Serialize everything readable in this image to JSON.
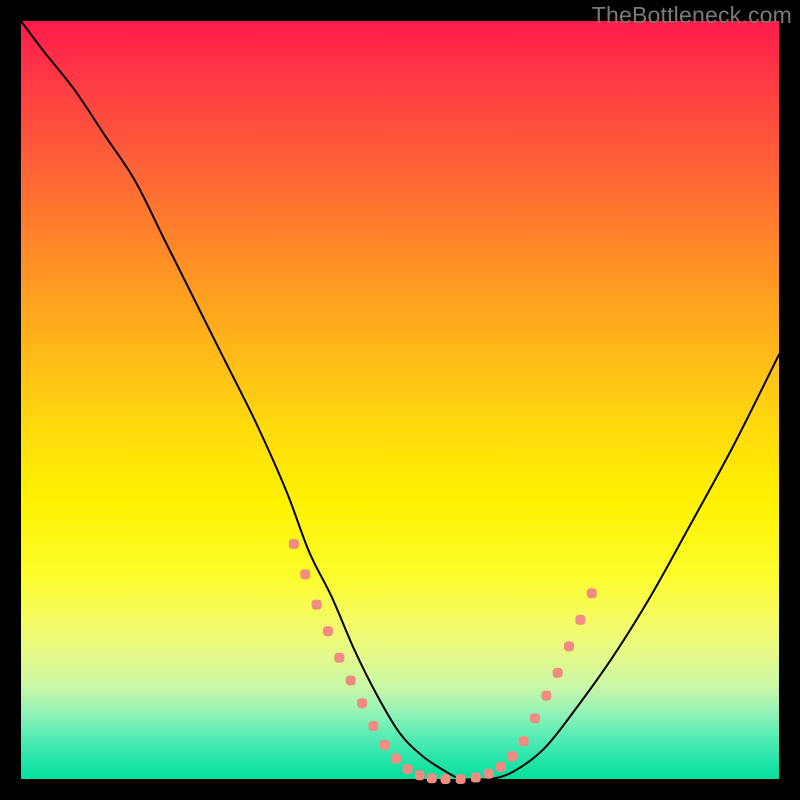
{
  "watermark": "TheBottleneck.com",
  "chart_data": {
    "type": "line",
    "title": "",
    "xlabel": "",
    "ylabel": "",
    "xlim": [
      0,
      100
    ],
    "ylim": [
      0,
      100
    ],
    "grid": false,
    "series": [
      {
        "name": "curve",
        "x": [
          0,
          3,
          7,
          11,
          15,
          19,
          23,
          27,
          31,
          35,
          38,
          41,
          44,
          47,
          50,
          53,
          56,
          58,
          60,
          62,
          65,
          69,
          73,
          78,
          83,
          88,
          94,
          100
        ],
        "y": [
          100,
          96,
          91,
          85,
          79,
          71,
          63,
          55,
          47,
          38,
          30,
          24,
          17,
          11,
          6,
          3,
          1,
          0,
          0,
          0,
          1,
          4,
          9,
          16,
          24,
          33,
          44,
          56
        ],
        "color": "#000000",
        "width": 2
      }
    ],
    "markers": {
      "name": "dotted-band",
      "color": "#f28b82",
      "size": 10,
      "points": [
        {
          "x": 36,
          "y": 31
        },
        {
          "x": 37.5,
          "y": 27
        },
        {
          "x": 39,
          "y": 23
        },
        {
          "x": 40.5,
          "y": 19.5
        },
        {
          "x": 42,
          "y": 16
        },
        {
          "x": 43.5,
          "y": 13
        },
        {
          "x": 45,
          "y": 10
        },
        {
          "x": 46.5,
          "y": 7
        },
        {
          "x": 48,
          "y": 4.5
        },
        {
          "x": 49.5,
          "y": 2.7
        },
        {
          "x": 51,
          "y": 1.3
        },
        {
          "x": 52.6,
          "y": 0.5
        },
        {
          "x": 54.2,
          "y": 0.1
        },
        {
          "x": 56,
          "y": 0
        },
        {
          "x": 58,
          "y": 0
        },
        {
          "x": 60,
          "y": 0.2
        },
        {
          "x": 61.7,
          "y": 0.7
        },
        {
          "x": 63.3,
          "y": 1.6
        },
        {
          "x": 64.8,
          "y": 3
        },
        {
          "x": 66.3,
          "y": 5
        },
        {
          "x": 67.8,
          "y": 8
        },
        {
          "x": 69.3,
          "y": 11
        },
        {
          "x": 70.8,
          "y": 14
        },
        {
          "x": 72.3,
          "y": 17.5
        },
        {
          "x": 73.8,
          "y": 21
        },
        {
          "x": 75.3,
          "y": 24.5
        }
      ]
    }
  }
}
